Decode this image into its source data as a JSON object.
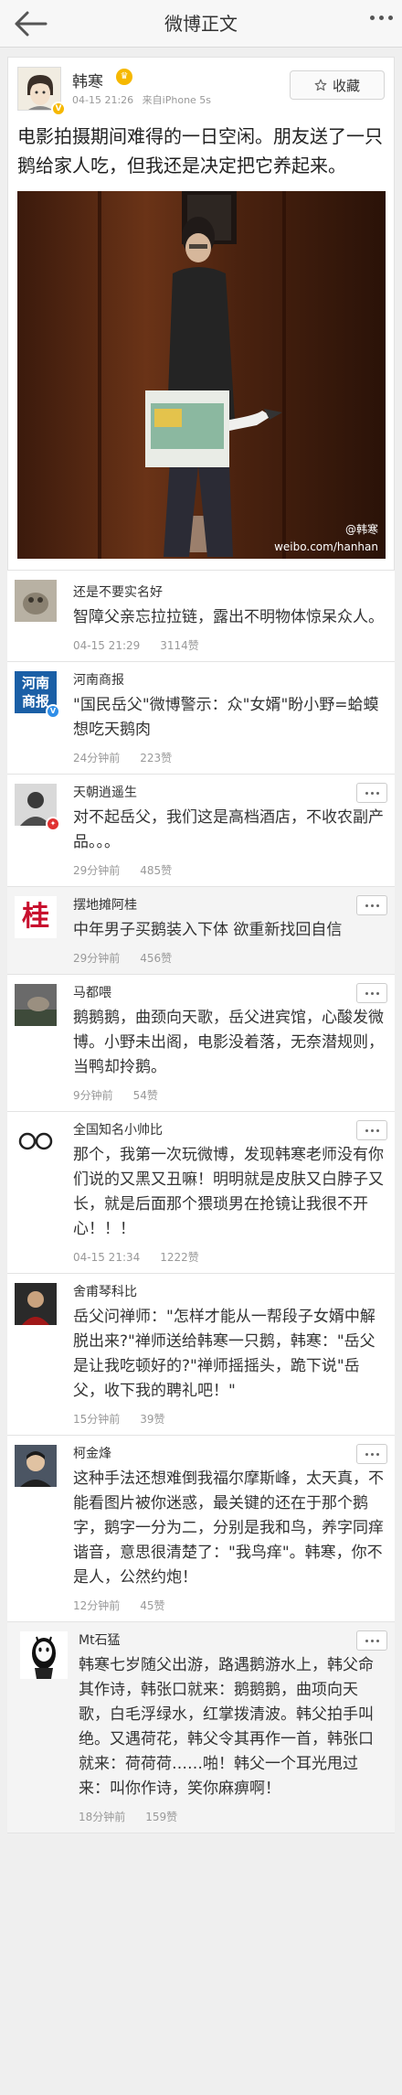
{
  "nav": {
    "title": "微博正文",
    "back_icon": "back-arrow-icon",
    "more_icon": "more-dots-icon"
  },
  "post": {
    "author": "韩寒",
    "time": "04-15 21:26",
    "source": "来自iPhone 5s",
    "favorite_label": "收藏",
    "text": "电影拍摄期间难得的一日空闲。朋友送了一只鹅给家人吃，但我还是决定把它养起来。",
    "photo_watermark_handle": "@韩寒",
    "photo_watermark_url": "weibo.com/hanhan"
  },
  "comments": [
    {
      "name": "还是不要实名好",
      "text": "智障父亲忘拉拉链，露出不明物体惊呆众人。",
      "time": "04-15 21:29",
      "likes": "3114赞"
    },
    {
      "name": "河南商报",
      "avatar_text": "河南\n商报",
      "text": "\"国民岳父\"微博警示：众\"女婿\"盼小野=蛤蟆想吃天鹅肉",
      "time": "24分钟前",
      "likes": "223赞"
    },
    {
      "name": "天朝逍遥生",
      "text": "对不起岳父，我们这是高档酒店，不收农副产品。。。",
      "time": "29分钟前",
      "likes": "485赞"
    },
    {
      "name": "摆地摊阿桂",
      "avatar_text": "桂",
      "text": "中年男子买鹅装入下体 欲重新找回自信",
      "time": "29分钟前",
      "likes": "456赞"
    },
    {
      "name": "马都喂",
      "text": "鹅鹅鹅，曲颈向天歌，岳父进宾馆，心酸发微博。小野未出阁，电影没着落，无奈潜规则，当鸭却拎鹅。",
      "time": "9分钟前",
      "likes": "54赞"
    },
    {
      "name": "全国知名小帅比",
      "text": "那个，我第一次玩微博，发现韩寒老师没有你们说的又黑又丑嘛！明明就是皮肤又白脖子又长，就是后面那个猥琐男在抢镜让我很不开心！！！",
      "time": "04-15 21:34",
      "likes": "1222赞"
    },
    {
      "name": "舍甫琴科比",
      "text": "岳父问禅师：\"怎样才能从一帮段子女婿中解脱出来?\"禅师送给韩寒一只鹅，韩寒：\"岳父是让我吃顿好的?\"禅师摇摇头，跪下说\"岳父，收下我的聘礼吧！\"",
      "time": "15分钟前",
      "likes": "39赞"
    },
    {
      "name": "柯金烽",
      "text": "这种手法还想难倒我福尔摩斯峰，太天真，不能看图片被你迷惑，最关键的还在于那个鹅字，鹅字一分为二，分别是我和鸟，养字同痒谐音，意思很清楚了：\"我鸟痒\"。韩寒，你不是人，公然约炮！",
      "time": "12分钟前",
      "likes": "45赞"
    },
    {
      "name": "Mt石猛",
      "text": "韩寒七岁随父出游，路遇鹅游水上，韩父命其作诗，韩张口就来：鹅鹅鹅，曲项向天歌，白毛浮绿水，红掌拨清波。韩父拍手叫绝。又遇荷花，韩父令其再作一首，韩张口就来：荷荷荷……啪！韩父一个耳光甩过来：叫你作诗，笑你麻痹啊！",
      "time": "18分钟前",
      "likes": "159赞"
    }
  ]
}
